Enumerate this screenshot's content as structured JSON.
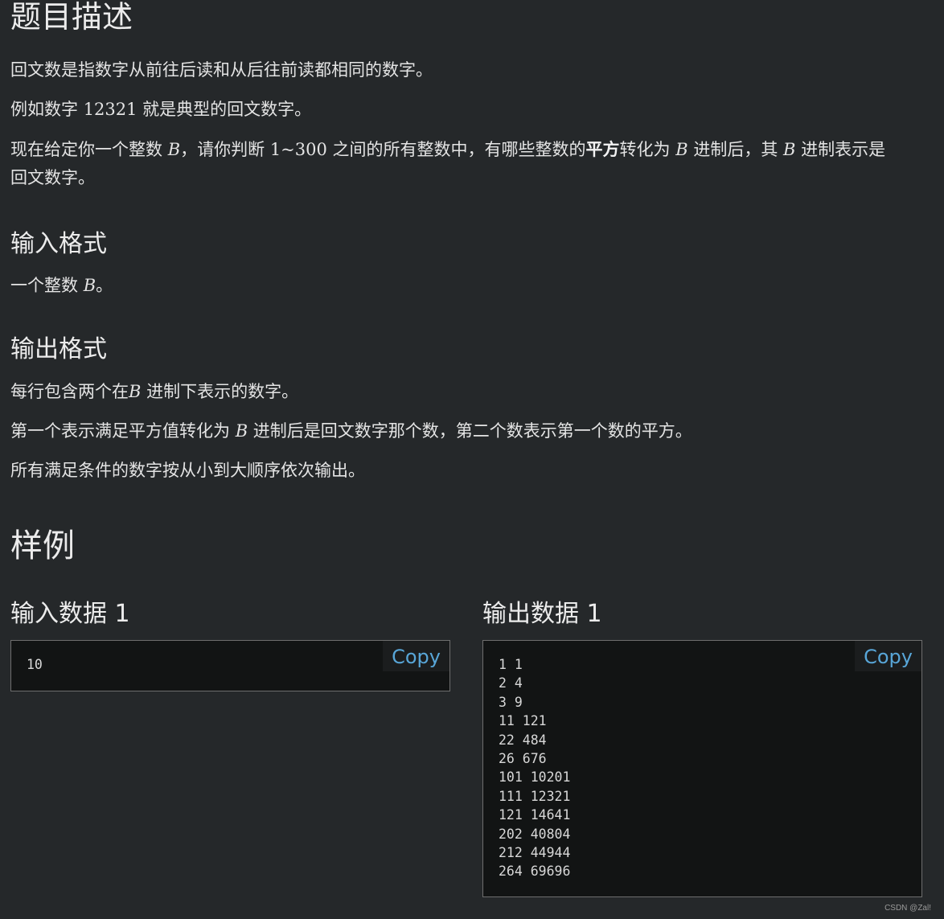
{
  "problem": {
    "title": "题目描述",
    "desc1": "回文数是指数字从前往后读和从后往前读都相同的数字。",
    "desc2_a": "例如数字 ",
    "desc2_num": "12321",
    "desc2_b": " 就是典型的回文数字。",
    "desc3_a": "现在给定你一个整数 ",
    "var_B": "B",
    "desc3_b": "，请你判断 ",
    "range": "1~300",
    "desc3_c": " 之间的所有整数中，有哪些整数的",
    "desc3_bold": "平方",
    "desc3_d": "转化为 ",
    "desc3_e": " 进制后，其 ",
    "desc3_f": " 进制表示是",
    "desc3_g": "回文数字。"
  },
  "input_format": {
    "heading": "输入格式",
    "line_a": "一个整数 ",
    "line_b": "。"
  },
  "output_format": {
    "heading": "输出格式",
    "line1_a": "每行包含两个在",
    "line1_b": " 进制下表示的数字。",
    "line2_a": "第一个表示满足平方值转化为 ",
    "line2_b": " 进制后是回文数字那个数，第二个数表示第一个数的平方。",
    "line3": "所有满足条件的数字按从小到大顺序依次输出。"
  },
  "samples": {
    "heading": "样例",
    "input_label": "输入数据 1",
    "output_label": "输出数据 1",
    "copy_label": "Copy",
    "input_lines": [
      "10"
    ],
    "output_lines": [
      "1 1",
      "2 4",
      "3 9",
      "11 121",
      "22 484",
      "26 676",
      "101 10201",
      "111 12321",
      "121 14641",
      "202 40804",
      "212 44944",
      "264 69696"
    ]
  },
  "watermark": "CSDN @Zal!"
}
